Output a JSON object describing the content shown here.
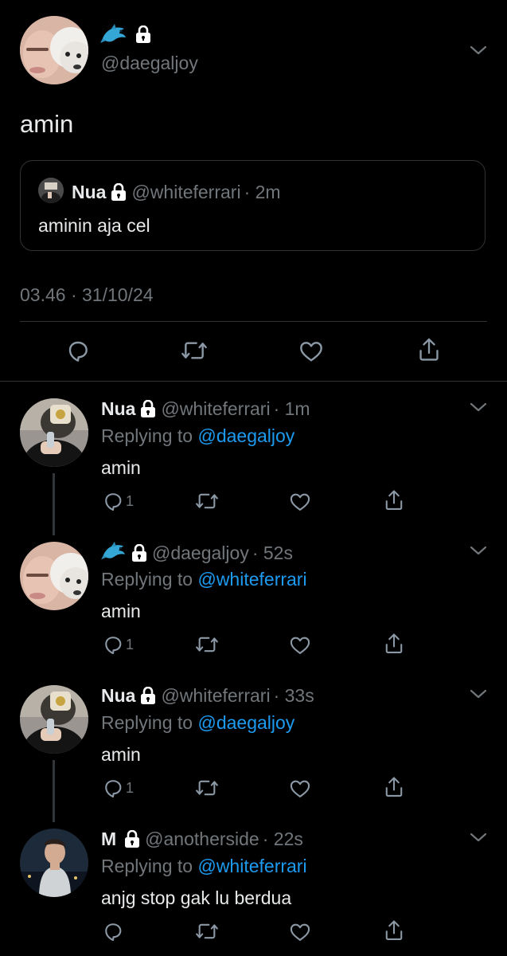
{
  "main_tweet": {
    "handle": "@daegaljoy",
    "text": "amin",
    "timestamp": "03.46 · 31/10/24",
    "quote": {
      "name": "Nua",
      "handle": "@whiteferrari",
      "time": "· 2m",
      "text": "aminin aja cel"
    }
  },
  "replies": [
    {
      "name": "Nua",
      "handle": "@whiteferrari",
      "time": "· 1m",
      "replying_label": "Replying to",
      "replying_to": "@daegaljoy",
      "text": "amin",
      "reply_count": "1"
    },
    {
      "name": "",
      "handle": "@daegaljoy",
      "time": "· 52s",
      "replying_label": "Replying to",
      "replying_to": "@whiteferrari",
      "text": "amin",
      "reply_count": "1"
    },
    {
      "name": "Nua",
      "handle": "@whiteferrari",
      "time": "· 33s",
      "replying_label": "Replying to",
      "replying_to": "@daegaljoy",
      "text": "amin",
      "reply_count": "1"
    },
    {
      "name": "M",
      "handle": "@anotherside",
      "time": "· 22s",
      "replying_label": "Replying to",
      "replying_to": "@whiteferrari",
      "text": "anjg stop gak lu berdua",
      "reply_count": ""
    }
  ],
  "colors": {
    "background": "#000000",
    "text": "#e7e9ea",
    "muted": "#71767b",
    "link": "#1d9bf0",
    "divider": "#2f3336"
  }
}
